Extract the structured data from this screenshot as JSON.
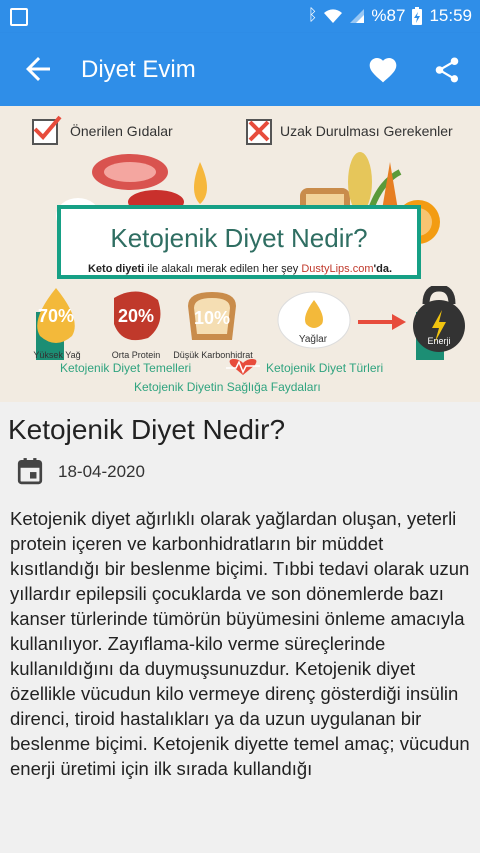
{
  "status_bar": {
    "battery": "%87",
    "time": "15:59"
  },
  "app_bar": {
    "title": "Diyet Evim"
  },
  "banner": {
    "recommended_label": "Önerilen Gıdalar",
    "avoid_label": "Uzak Durulması Gerekenler",
    "headline": "Ketojenik Diyet Nedir?",
    "subtitle_pre": "Keto diyeti",
    "subtitle_mid": " ile alakalı merak edilen her şey ",
    "subtitle_brand": "DustyLips.com",
    "subtitle_post": "'da.",
    "macro1_pct": "70%",
    "macro1_label": "Yüksek Yağ",
    "macro2_pct": "20%",
    "macro2_label": "Orta Protein",
    "macro3_pct": "10%",
    "macro3_label": "Düşük Karbonhidrat",
    "fat_label": "Yağlar",
    "energy_label": "Enerji",
    "link1": "Ketojenik Diyet Temelleri",
    "link2": "Ketojenik Diyet Türleri",
    "link3": "Ketojenik Diyetin Sağlığa Faydaları"
  },
  "article": {
    "title": "Ketojenik Diyet Nedir?",
    "date": "18-04-2020",
    "body": "Ketojenik diyet ağırlıklı olarak yağlardan oluşan, yeterli protein içeren ve karbonhidratların bir müddet kısıtlandığı bir beslenme biçimi. Tıbbi tedavi olarak uzun yıllardır epilepsili çocuklarda ve son dönemlerde bazı kanser türlerinde tümörün büyümesini önleme amacıyla kullanılıyor. Zayıflama-kilo verme süreçlerinde kullanıldığını da duymuşsunuzdur. Ketojenik diyet özellikle vücudun kilo vermeye direnç gösterdiği insülin direnci, tiroid hastalıkları ya da uzun uygulanan bir beslenme biçimi. Ketojenik diyette temel amaç; vücudun enerji üretimi için ilk sırada kullandığı"
  }
}
